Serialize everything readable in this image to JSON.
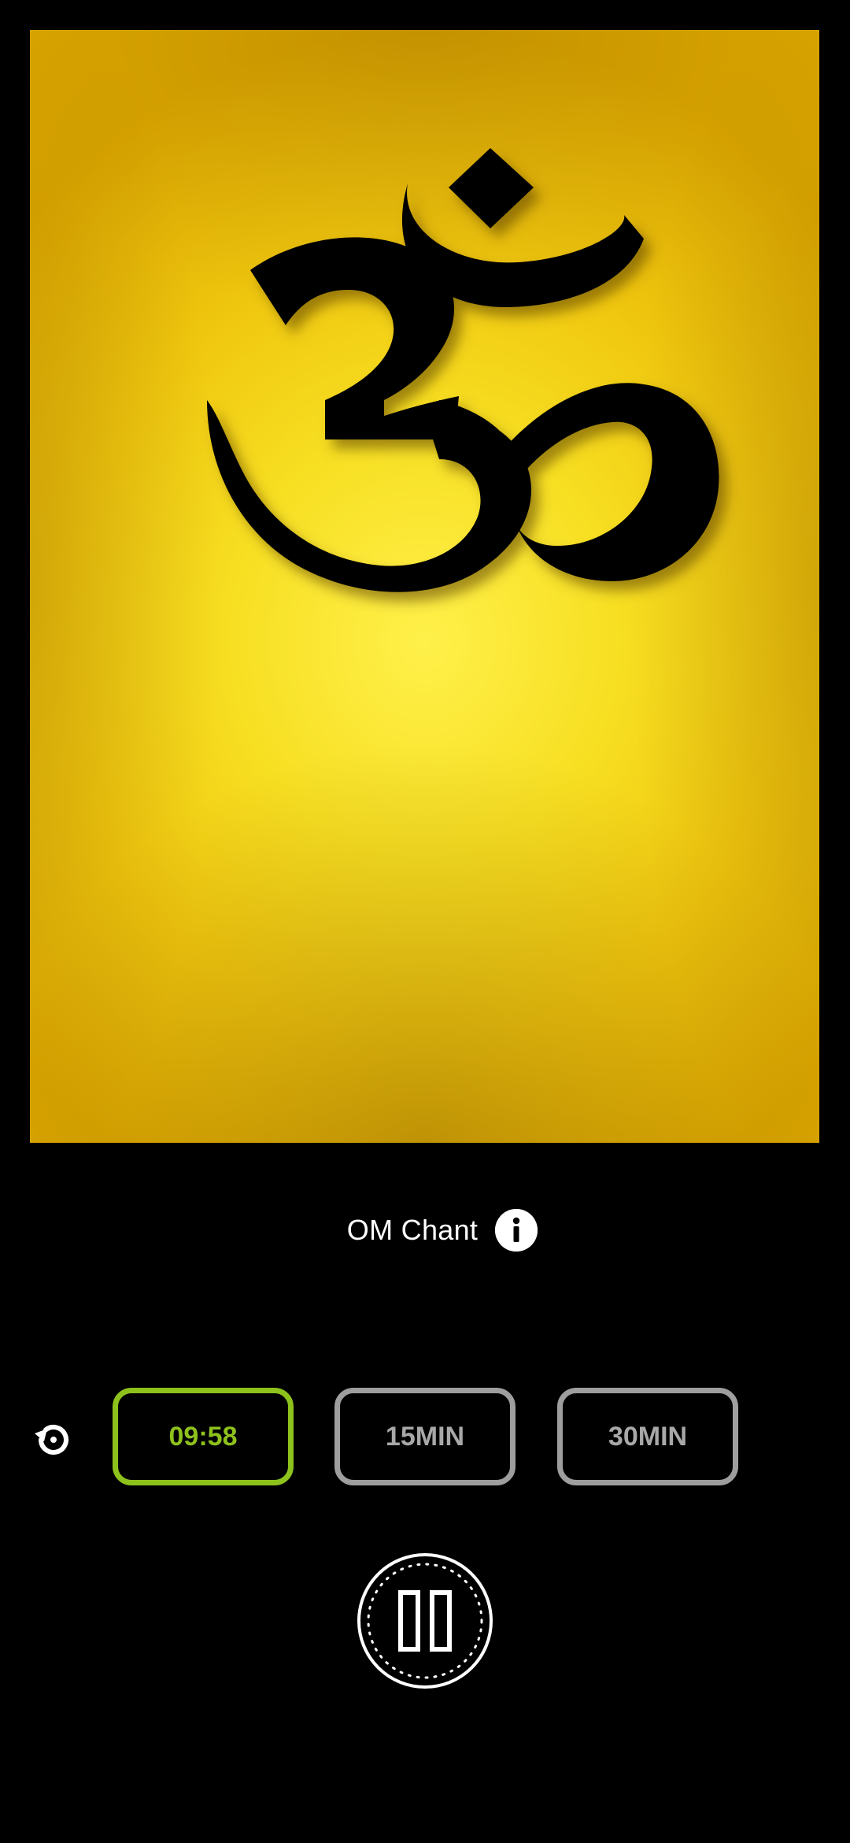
{
  "app": {
    "track_title": "OM Chant"
  },
  "artwork": {
    "symbol": "om-symbol",
    "background_color": "#f2d11a",
    "symbol_color": "#000000"
  },
  "timer": {
    "options": [
      {
        "label": "09:58",
        "active": true
      },
      {
        "label": "15MIN",
        "active": false
      },
      {
        "label": "30MIN",
        "active": false
      }
    ],
    "active_color": "#8dc11c",
    "inactive_color": "#9e9e9e"
  },
  "controls": {
    "reset_icon": "restart-icon",
    "info_icon": "info-icon",
    "playback_icon": "pause-icon",
    "state": "playing"
  }
}
